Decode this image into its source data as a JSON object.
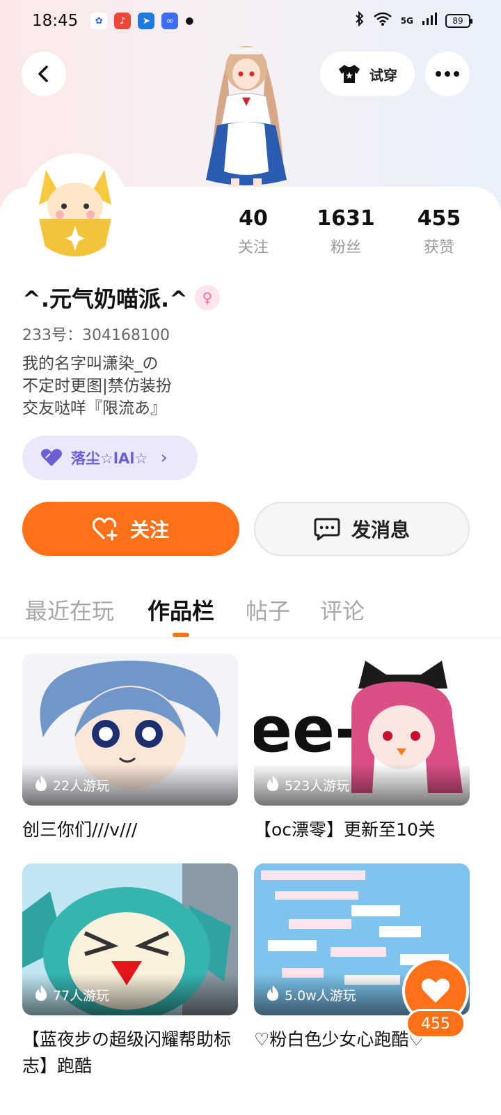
{
  "status_bar": {
    "time": "18:45",
    "network": "5G",
    "battery": "89"
  },
  "header": {
    "back_icon": "chevron-left-icon",
    "tryon_label": "试穿",
    "more_icon": "more-dots-icon"
  },
  "stats": [
    {
      "value": "40",
      "label": "关注"
    },
    {
      "value": "1631",
      "label": "粉丝"
    },
    {
      "value": "455",
      "label": "获赞"
    }
  ],
  "profile": {
    "nickname": "^.元气奶喵派.^",
    "gender_symbol": "♀",
    "uid": "233号：304168100",
    "bio_lines": [
      "我的名字叫潇染_の",
      "不定时更图|禁仿装扮",
      "交友哒咩『限流あ』"
    ]
  },
  "guild": {
    "name": "落尘☆lAl☆",
    "arrow": "›"
  },
  "actions": {
    "follow_label": "关注",
    "message_label": "发消息"
  },
  "tabs": [
    {
      "label": "最近在玩"
    },
    {
      "label": "作品栏"
    },
    {
      "label": "帖子"
    },
    {
      "label": "评论"
    }
  ],
  "works": [
    {
      "plays": "22人游玩",
      "title": "创三你们///v///"
    },
    {
      "plays": "523人游玩",
      "title": "【oc漂零】更新至10关"
    },
    {
      "plays": "77人游玩",
      "title": "【蓝夜步の超级闪耀帮助标志】跑酷"
    },
    {
      "plays": "5.0w人游玩",
      "title": "♡粉白色少女心跑酷♡"
    }
  ],
  "like_float": {
    "count": "455"
  },
  "colors": {
    "accent": "#ff7117",
    "guild_bg": "#ebe8fb",
    "guild_text": "#6b5fd6"
  }
}
